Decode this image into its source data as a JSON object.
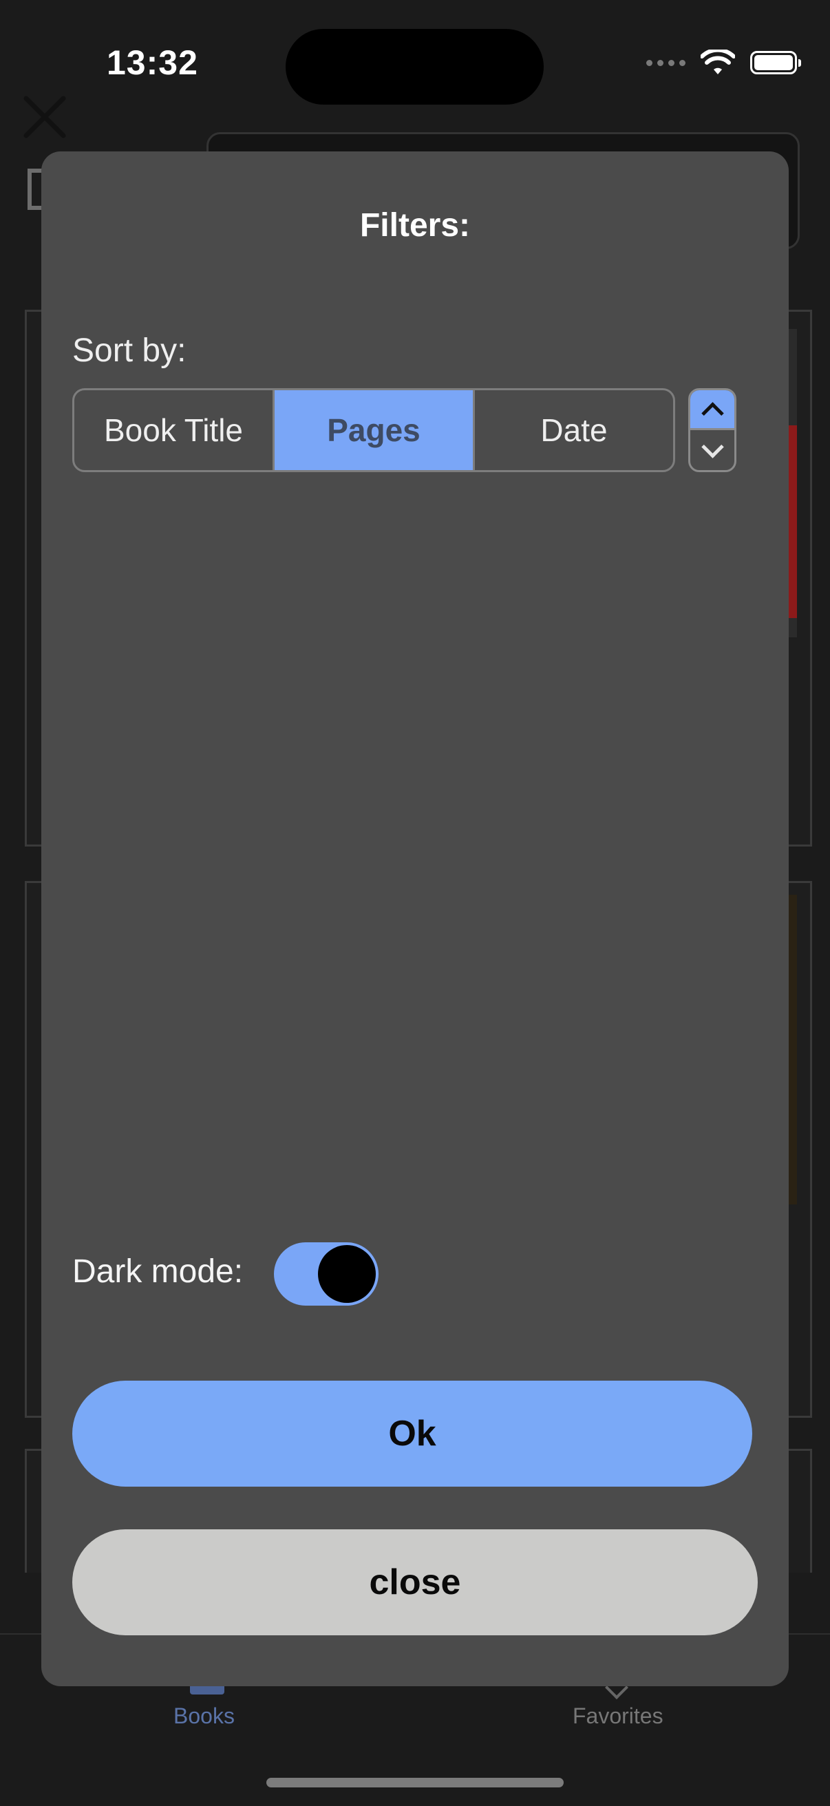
{
  "status_bar": {
    "time": "13:32"
  },
  "tabbar": {
    "books_label": "Books",
    "favorites_label": "Favorites"
  },
  "modal": {
    "title": "Filters:",
    "sort_label": "Sort by:",
    "sort_options": [
      "Book Title",
      "Pages",
      "Date"
    ],
    "selected_sort": "Pages",
    "sort_order": "ascending",
    "dark_mode_label": "Dark mode:",
    "dark_mode_on": true,
    "ok_label": "Ok",
    "close_label": "close"
  },
  "colors": {
    "accent": "#7aa6f7",
    "modal_bg": "#4b4b4b",
    "close_button": "#cbcbc9",
    "app_bg": "#1b1b1b"
  }
}
